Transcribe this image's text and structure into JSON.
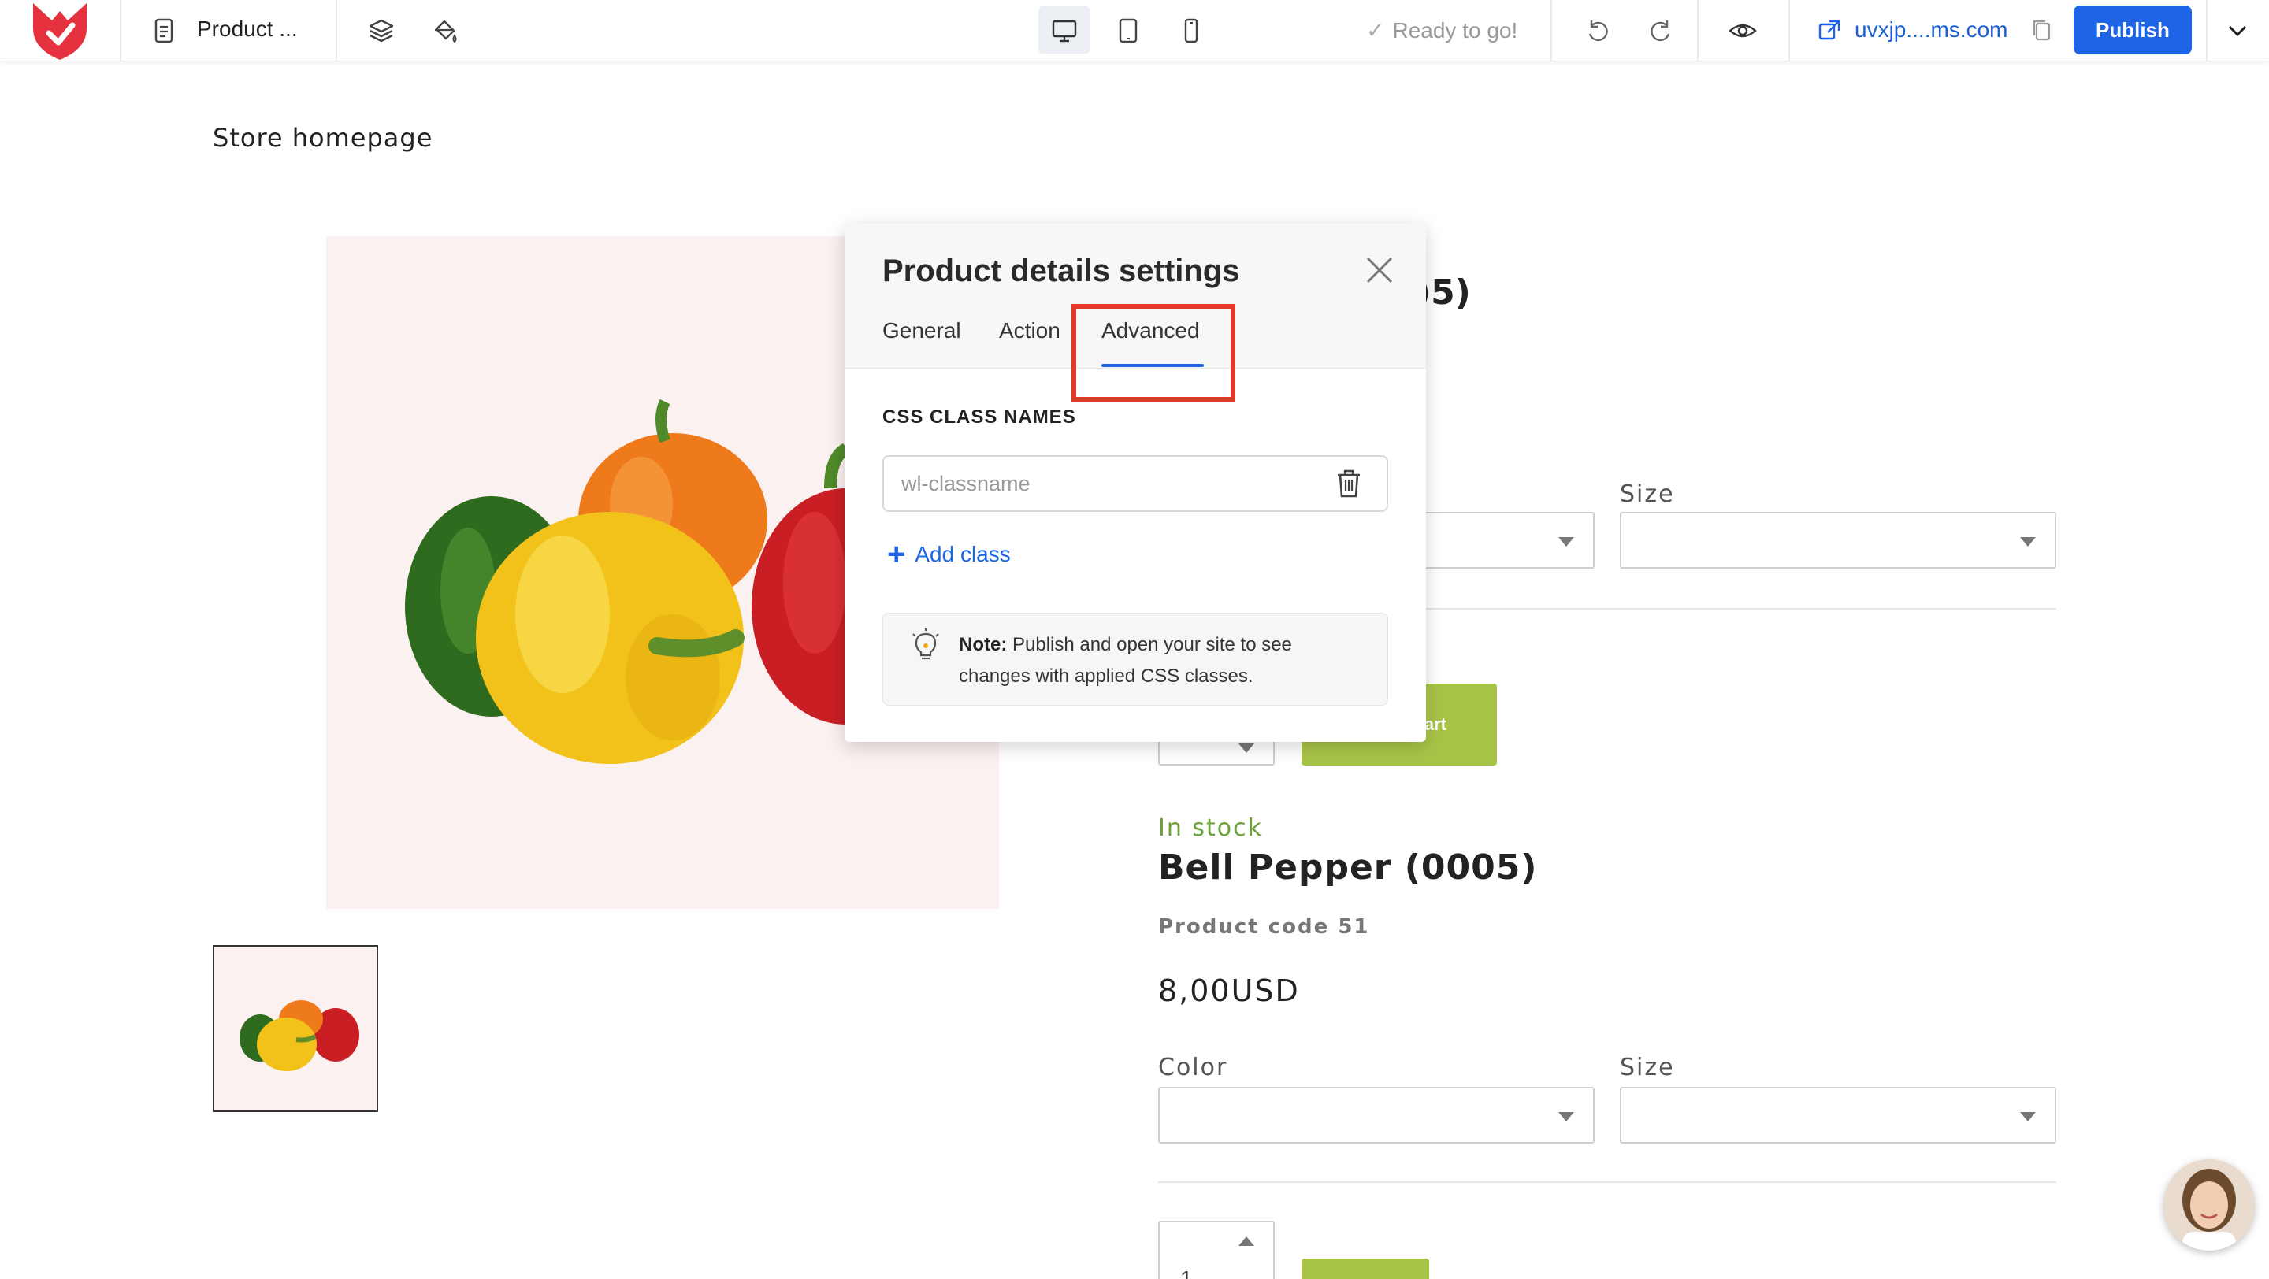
{
  "toolbar": {
    "page_name": "Product ...",
    "status": "Ready to go!",
    "domain": "uvxjp....ms.com",
    "publish_label": "Publish"
  },
  "store": {
    "title": "Store homepage",
    "partial_title_fragment": ")5)",
    "size_label_top": "Size",
    "add_to_cart_fragment": "art"
  },
  "product": {
    "stock": "In stock",
    "title": "Bell Pepper (0005)",
    "code": "Product code 51",
    "price": "8,00USD",
    "color_label": "Color",
    "size_label": "Size",
    "quantity": "1"
  },
  "popup": {
    "title": "Product details settings",
    "tabs": [
      {
        "label": "General"
      },
      {
        "label": "Action"
      },
      {
        "label": "Advanced"
      }
    ],
    "active_tab": "Advanced",
    "section_heading": "CSS CLASS NAMES",
    "class_input_placeholder": "wl-classname",
    "add_class_label": "Add class",
    "note_bold": "Note:",
    "note_text": " Publish and open your site to see changes with applied CSS classes."
  },
  "colors": {
    "accent": "#1d65e6",
    "brand_red": "#e5323e",
    "stock_green": "#6ba13a",
    "cart_green": "#a8c447",
    "highlight": "#e03a2d"
  }
}
